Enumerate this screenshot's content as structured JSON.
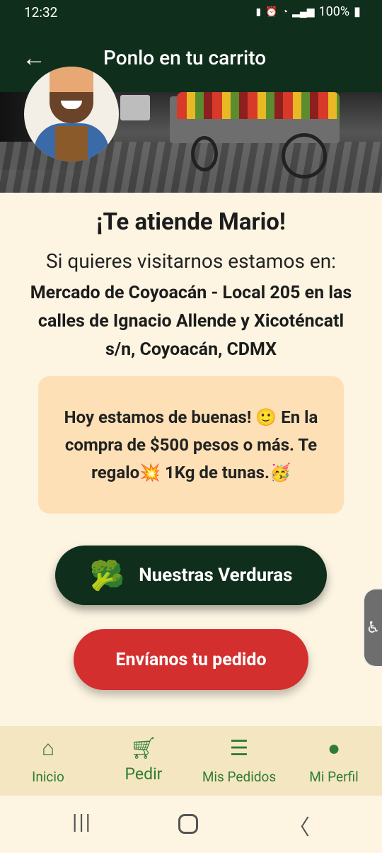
{
  "status_bar": {
    "time": "12:32",
    "icons": [
      "battery-saver-icon",
      "alarm-icon",
      "wifi-icon",
      "signal-icon"
    ],
    "battery": "100%"
  },
  "app_bar": {
    "title": "Ponlo en tu carrito",
    "back_icon": "arrow-back-icon"
  },
  "hero": {
    "image": "street-market-cart-photo",
    "avatar": "vendor-avatar-illustration"
  },
  "content": {
    "greeting": "¡Te atiende Mario!",
    "visit_text": "Si quieres visitarnos estamos en:",
    "address": "Mercado de Coyoacán - Local 205 en las calles de Ignacio Allende y Xicoténcatl s/n, Coyoacán, CDMX",
    "promo": "Hoy estamos de buenas! 🙂 En la compra de $500 pesos o más. Te regalo💥 1Kg de tunas.🥳"
  },
  "buttons": {
    "verduras_emoji": "🥦",
    "verduras_label": "Nuestras Verduras",
    "pedido_label": "Envíanos tu pedido"
  },
  "accessibility_tab": {
    "icon": "accessibility-icon"
  },
  "bottom_nav": {
    "items": [
      {
        "label": "Inicio",
        "icon": "home-icon",
        "active": false
      },
      {
        "label": "Pedir",
        "icon": "cart-icon",
        "active": true
      },
      {
        "label": "Mis Pedidos",
        "icon": "list-icon",
        "active": false
      },
      {
        "label": "Mi Perfil",
        "icon": "person-icon",
        "active": false
      }
    ]
  },
  "colors": {
    "primary_dark": "#0f2e1b",
    "accent_red": "#d32f2f",
    "background": "#fdf5e2",
    "promo_bg": "#fde0b6",
    "nav_green": "#2e7d32"
  }
}
